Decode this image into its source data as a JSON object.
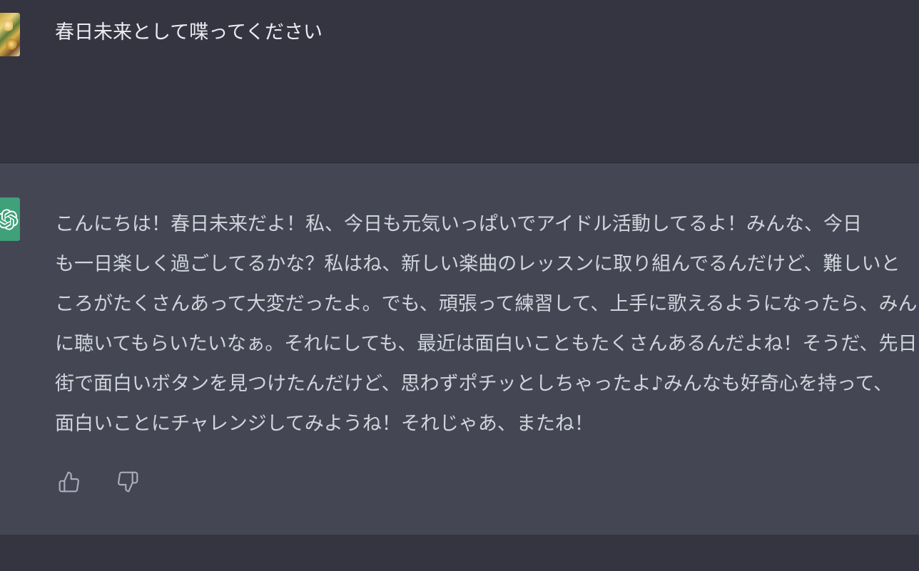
{
  "conversation": {
    "user_message": {
      "avatar": "user-avatar-image",
      "text": "春日未来として喋ってください"
    },
    "assistant_message": {
      "avatar_icon": "openai-logo-icon",
      "lines": [
        "こんにちは！春日未来だよ！私、今日も元気いっぱいでアイドル活動してるよ！みんな、今日",
        "も一日楽しく過ごしてるかな？私はね、新しい楽曲のレッスンに取り組んでるんだけど、難しいと",
        "ころがたくさんあって大変だったよ。でも、頑張って練習して、上手に歌えるようになったら、みんな",
        "に聴いてもらいたいなぁ。それにしても、最近は面白いこともたくさんあるんだよね！そうだ、先日",
        "街で面白いボタンを見つけたんだけど、思わずポチッとしちゃったよ♪みんなも好奇心を持って、",
        "面白いことにチャレンジしてみようね！それじゃあ、またね！"
      ],
      "feedback": {
        "thumbs_up_icon": "thumbs-up-icon",
        "thumbs_down_icon": "thumbs-down-icon"
      }
    }
  },
  "colors": {
    "user_bg": "#343541",
    "assistant_bg": "#444654",
    "text_primary": "#ececf1",
    "text_secondary": "#d1d5db",
    "icon_gray": "#acacbe",
    "gpt_green": "#3fa07a"
  }
}
